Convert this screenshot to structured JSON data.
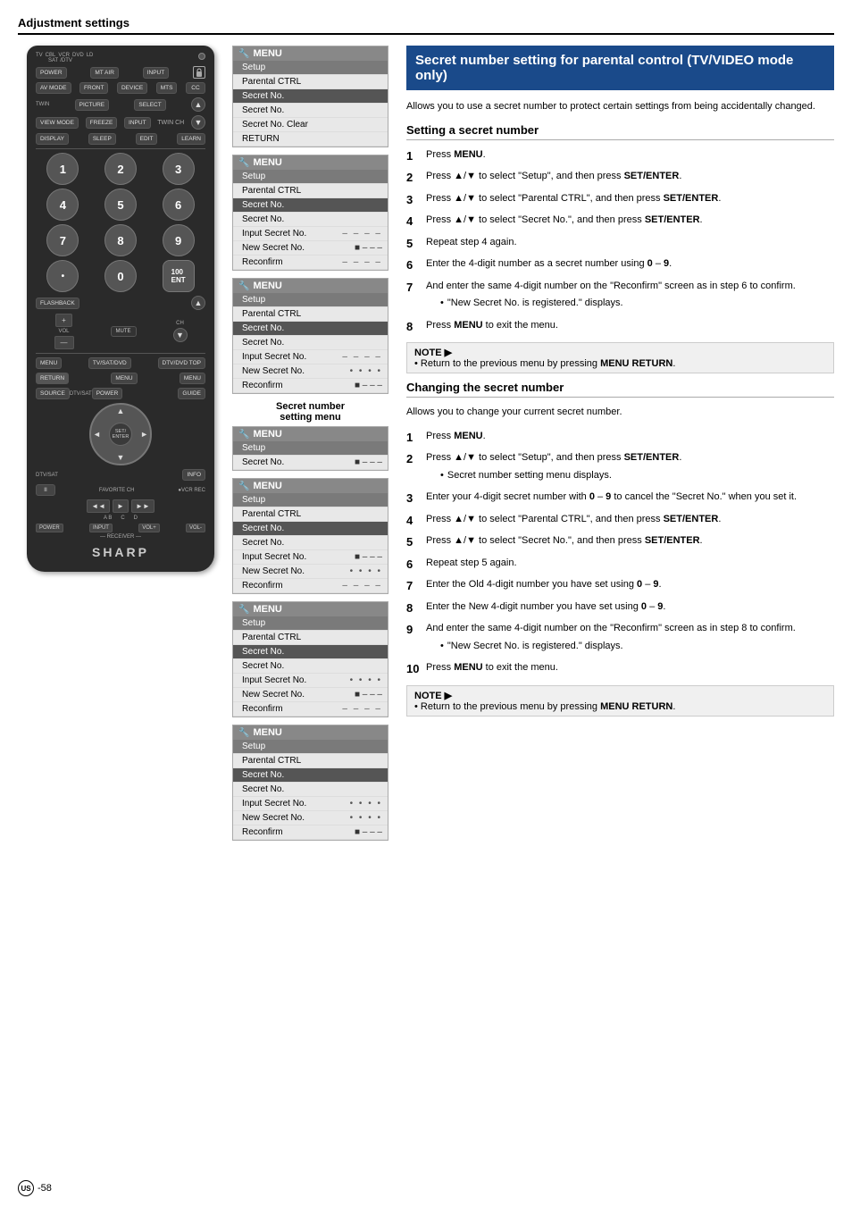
{
  "page": {
    "section_title": "Adjustment settings",
    "footer_circle": "US",
    "footer_page": "-58"
  },
  "remote": {
    "brand": "SHARP",
    "labels_top": [
      "TV",
      "CBL",
      "VCR",
      "DVD",
      "LD"
    ],
    "label_sat": "SAT",
    "label_dtv": "/DTV",
    "buttons": {
      "power": "POWER",
      "mt_air": "MT AIR",
      "input": "INPUT",
      "av_mode": "AV MODE",
      "front": "FRONT",
      "device": "DEVICE",
      "mts": "MTS",
      "cc": "CC",
      "twin": "TWIN",
      "picture": "PICTURE",
      "select": "SELECT",
      "twin_ch": "TWIN CH",
      "view_mode": "VIEW MODE",
      "freeze": "FREEZE",
      "input2": "INPUT",
      "display": "DISPLAY",
      "sleep": "SLEEP",
      "edit": "EDIT",
      "learn": "LEARN",
      "flashback": "FLASHBACK",
      "vol_plus": "+",
      "vol": "VOL",
      "vol_minus": "—",
      "ch": "CH",
      "mute": "MUTE",
      "menu_btn": "MENU",
      "tv_sat_dvd": "TV/SAT/DVD",
      "dtv_dvd_top": "DTV/DVD TOP",
      "return": "RETURN",
      "menu2": "MENU",
      "menu3": "MENU",
      "source": "SOURCE",
      "dtv_sat": "DTV/SAT",
      "power2": "POWER",
      "guide": "GUIDE",
      "set_enter": "SET/\nENTER",
      "dtv_sat2": "DTV/SAT",
      "info": "INFO",
      "pause": "II",
      "fav_ch": "FAVORITE CH",
      "vcr_rec": "●VCR REC",
      "rw": "◄◄",
      "play": "►",
      "ff": "►►",
      "power3": "POWER",
      "input3": "INPUT",
      "vol_plus2": "VOL+",
      "vol_minus2": "VOL-",
      "receiver": "— RECEIVER —",
      "ab": "A  B",
      "cd": "C  D"
    },
    "numbers": [
      "1",
      "2",
      "3",
      "4",
      "5",
      "6",
      "7",
      "8",
      "9",
      "•",
      "0",
      "100ENT"
    ]
  },
  "menu_boxes": {
    "box1": {
      "title": "MENU",
      "items": [
        {
          "label": "Setup",
          "type": "selected"
        },
        {
          "label": "Parental CTRL",
          "type": "normal"
        },
        {
          "label": "Secret No.",
          "type": "highlighted"
        },
        {
          "label": "Secret No.",
          "type": "normal"
        },
        {
          "label": "Secret No. Clear",
          "type": "normal"
        },
        {
          "label": "RETURN",
          "type": "normal"
        }
      ]
    },
    "box2": {
      "title": "MENU",
      "items": [
        {
          "label": "Setup",
          "type": "selected"
        },
        {
          "label": "Parental CTRL",
          "type": "normal"
        },
        {
          "label": "Secret No.",
          "type": "highlighted"
        },
        {
          "label": "Secret No.",
          "type": "normal"
        },
        {
          "label": "Input Secret No.",
          "type": "normal",
          "value": "– – – –"
        },
        {
          "label": "New Secret No.",
          "type": "normal",
          "value": "■ – – –"
        },
        {
          "label": "Reconfirm",
          "type": "normal",
          "value": "– – – –"
        }
      ]
    },
    "box3": {
      "title": "MENU",
      "items": [
        {
          "label": "Setup",
          "type": "selected"
        },
        {
          "label": "Parental CTRL",
          "type": "normal"
        },
        {
          "label": "Secret No.",
          "type": "highlighted"
        },
        {
          "label": "Secret No.",
          "type": "normal"
        },
        {
          "label": "Input Secret No.",
          "type": "normal",
          "value": "– – – –"
        },
        {
          "label": "New Secret No.",
          "type": "normal",
          "value": "• • • •"
        },
        {
          "label": "Reconfirm",
          "type": "normal",
          "value": "■ – – –"
        }
      ]
    },
    "secret_setting_label": "Secret number\nsetting menu",
    "box4": {
      "title": "MENU",
      "items": [
        {
          "label": "Setup",
          "type": "selected"
        },
        {
          "label": "Secret No.",
          "type": "normal",
          "value": "■ – – –"
        }
      ]
    },
    "box5": {
      "title": "MENU",
      "items": [
        {
          "label": "Setup",
          "type": "selected"
        },
        {
          "label": "Parental CTRL",
          "type": "normal"
        },
        {
          "label": "Secret No.",
          "type": "highlighted"
        },
        {
          "label": "Secret No.",
          "type": "normal"
        },
        {
          "label": "Input Secret No.",
          "type": "normal",
          "value": "■ – – –"
        },
        {
          "label": "New Secret No.",
          "type": "normal",
          "value": "• • • •"
        },
        {
          "label": "Reconfirm",
          "type": "normal",
          "value": "– – – –"
        }
      ]
    },
    "box6": {
      "title": "MENU",
      "items": [
        {
          "label": "Setup",
          "type": "selected"
        },
        {
          "label": "Parental CTRL",
          "type": "normal"
        },
        {
          "label": "Secret No.",
          "type": "highlighted"
        },
        {
          "label": "Secret No.",
          "type": "normal"
        },
        {
          "label": "Input Secret No.",
          "type": "normal",
          "value": "• • • •"
        },
        {
          "label": "New Secret No.",
          "type": "normal",
          "value": "■ – – –"
        },
        {
          "label": "Reconfirm",
          "type": "normal",
          "value": "– – – –"
        }
      ]
    },
    "box7": {
      "title": "MENU",
      "items": [
        {
          "label": "Setup",
          "type": "selected"
        },
        {
          "label": "Parental CTRL",
          "type": "normal"
        },
        {
          "label": "Secret No.",
          "type": "highlighted"
        },
        {
          "label": "Secret No.",
          "type": "normal"
        },
        {
          "label": "Input Secret No.",
          "type": "normal",
          "value": "• • • •"
        },
        {
          "label": "New Secret No.",
          "type": "normal",
          "value": "• • • •"
        },
        {
          "label": "Reconfirm",
          "type": "normal",
          "value": "■ – – –"
        }
      ]
    }
  },
  "right_column": {
    "title": "Secret number setting for parental control (TV/VIDEO mode only)",
    "intro": "Allows you to use a secret number to protect certain settings from being accidentally changed.",
    "section1_title": "Setting a secret number",
    "steps1": [
      {
        "num": "1",
        "text": "Press <b>MENU</b>."
      },
      {
        "num": "2",
        "text": "Press ▲/▼ to select \"Setup\", and then press <b>SET/ENTER</b>."
      },
      {
        "num": "3",
        "text": "Press ▲/▼ to select \"Parental CTRL\", and then press <b>SET/ENTER</b>."
      },
      {
        "num": "4",
        "text": "Press ▲/▼ to select \"Secret No.\", and then press <b>SET/ENTER</b>."
      },
      {
        "num": "5",
        "text": "Repeat step 4 again."
      },
      {
        "num": "6",
        "text": "Enter the 4-digit number as a secret number using <b>0</b> – <b>9</b>."
      },
      {
        "num": "7",
        "text": "And enter the same 4-digit number on the \"Reconfirm\" screen as in step 6 to confirm.",
        "bullet": "\"New Secret No. is registered.\" displays."
      },
      {
        "num": "8",
        "text": "Press <b>MENU</b> to exit the menu."
      }
    ],
    "note1": "Return to the previous menu by pressing <b>MENU RETURN</b>.",
    "section2_title": "Changing the secret number",
    "section2_intro": "Allows you to change your current secret number.",
    "steps2": [
      {
        "num": "1",
        "text": "Press <b>MENU</b>."
      },
      {
        "num": "2",
        "text": "Press ▲/▼ to select \"Setup\", and then press <b>SET/ENTER</b>.",
        "bullet": "Secret number setting menu displays."
      },
      {
        "num": "3",
        "text": "Enter your 4-digit secret number with <b>0</b> – <b>9</b> to cancel the \"Secret No.\" when you set it."
      },
      {
        "num": "4",
        "text": "Press ▲/▼ to select \"Parental CTRL\", and then press <b>SET/ENTER</b>."
      },
      {
        "num": "5",
        "text": "Press ▲/▼ to select \"Secret No.\", and then press <b>SET/ENTER</b>."
      },
      {
        "num": "6",
        "text": "Repeat step 5 again."
      },
      {
        "num": "7",
        "text": "Enter the Old 4-digit number you have set using <b>0</b> – <b>9</b>."
      },
      {
        "num": "8",
        "text": "Enter the New 4-digit number you have set using <b>0</b> – <b>9</b>."
      },
      {
        "num": "9",
        "text": "And enter the same 4-digit number on the \"Reconfirm\" screen as in step 8 to confirm.",
        "bullet": "\"New Secret No. is registered.\" displays."
      },
      {
        "num": "10",
        "text": "Press <b>MENU</b> to exit the menu."
      }
    ],
    "note2": "Return to the previous menu by pressing <b>MENU RETURN</b>."
  }
}
